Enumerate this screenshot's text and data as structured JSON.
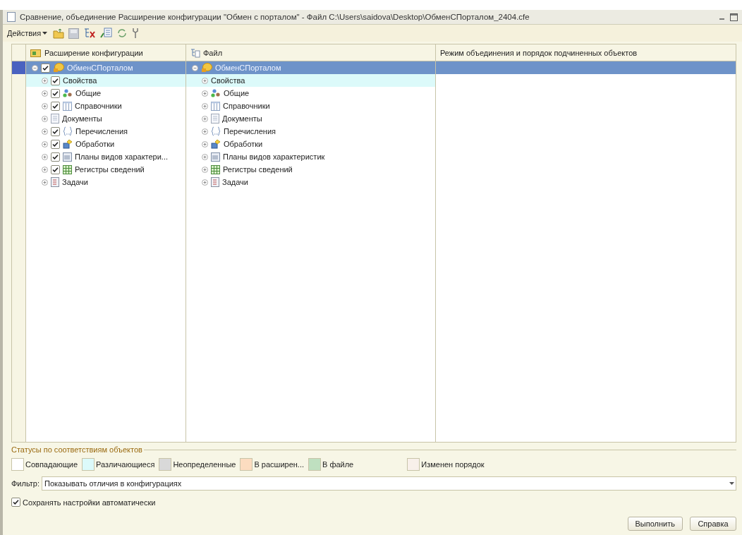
{
  "window": {
    "title": "Сравнение, объединение Расширение конфигурации \"Обмен с порталом\" - Файл C:\\Users\\saidova\\Desktop\\ОбменСПорталом_2404.cfe"
  },
  "toolbar": {
    "actions_label": "Действия"
  },
  "table": {
    "columns": [
      "Расширение конфигурации",
      "Файл",
      "Режим объединения и порядок подчиненных объектов"
    ],
    "rows": [
      {
        "kind": "config",
        "expanded": true,
        "selected": true,
        "in_extension": true,
        "left": "ОбменСПорталом",
        "right": "ОбменСПорталом"
      },
      {
        "kind": "properties",
        "expanded": false,
        "selected": false,
        "color": "#dcfafa",
        "in_extension": true,
        "left": "Свойства",
        "right": "Свойства"
      },
      {
        "kind": "common",
        "expanded": false,
        "selected": false,
        "in_extension": true,
        "left": "Общие",
        "right": "Общие"
      },
      {
        "kind": "catalog",
        "expanded": false,
        "selected": false,
        "in_extension": true,
        "left": "Справочники",
        "right": "Справочники"
      },
      {
        "kind": "document",
        "expanded": false,
        "selected": false,
        "in_extension": false,
        "left": "Документы",
        "right": "Документы"
      },
      {
        "kind": "enum",
        "expanded": false,
        "selected": false,
        "in_extension": true,
        "left": "Перечисления",
        "right": "Перечисления"
      },
      {
        "kind": "processor",
        "expanded": false,
        "selected": false,
        "in_extension": true,
        "left": "Обработки",
        "right": "Обработки"
      },
      {
        "kind": "chart",
        "expanded": false,
        "selected": false,
        "in_extension": true,
        "left": "Планы видов характери...",
        "right": "Планы видов характеристик"
      },
      {
        "kind": "register",
        "expanded": false,
        "selected": false,
        "in_extension": true,
        "left": "Регистры сведений",
        "right": "Регистры сведений"
      },
      {
        "kind": "task",
        "expanded": false,
        "selected": false,
        "in_extension": false,
        "left": "Задачи",
        "right": "Задачи"
      }
    ]
  },
  "legend": {
    "title": "Статусы по соответствиям объектов",
    "items": [
      {
        "label": "Совпадающие",
        "color": "#ffffff"
      },
      {
        "label": "Различающиеся",
        "color": "#dcfafa"
      },
      {
        "label": "Неопределенные",
        "color": "#d9d9d9"
      },
      {
        "label": "В расширен...",
        "color": "#fcdcc0"
      },
      {
        "label": "В файле",
        "color": "#bfe0c0"
      },
      {
        "label": "Изменен порядок",
        "color": "#f8f0ea"
      }
    ]
  },
  "filter": {
    "label": "Фильтр:",
    "value": "Показывать отличия в конфигурациях"
  },
  "autosave": {
    "label": "Сохранять настройки автоматически",
    "checked": true
  },
  "buttons": [
    "Выполнить",
    "Справка"
  ]
}
